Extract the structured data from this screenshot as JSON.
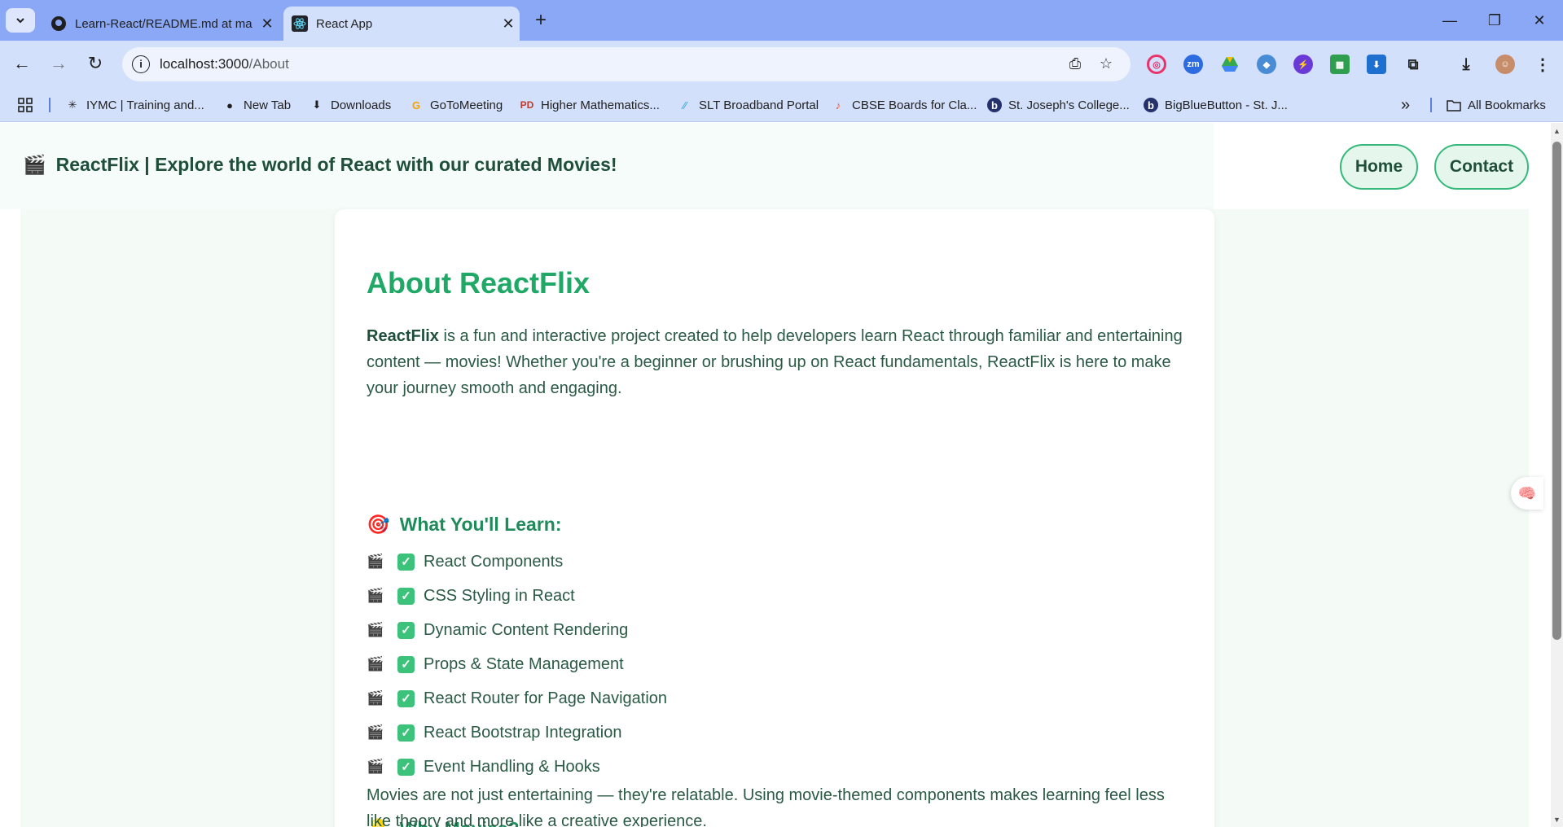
{
  "browser": {
    "tabs": [
      {
        "title": "Learn-React/README.md at ma",
        "favicon": "github-icon",
        "active": false
      },
      {
        "title": "React App",
        "favicon": "react-icon",
        "active": true
      }
    ],
    "url_host": "localhost:3000",
    "url_path": "/About",
    "bookmarks": [
      {
        "label": "IYMC | Training and...",
        "icon": "iymc-icon"
      },
      {
        "label": "New Tab",
        "icon": "globe-icon"
      },
      {
        "label": "Downloads",
        "icon": "download-icon"
      },
      {
        "label": "GoToMeeting",
        "icon": "gotomeeting-icon"
      },
      {
        "label": "Higher Mathematics...",
        "icon": "pdf-icon"
      },
      {
        "label": "SLT Broadband Portal",
        "icon": "slt-icon"
      },
      {
        "label": "CBSE Boards for Cla...",
        "icon": "cbse-icon"
      },
      {
        "label": "St. Joseph's College...",
        "icon": "bigbluebutton-icon"
      },
      {
        "label": "BigBlueButton - St. J...",
        "icon": "bigbluebutton-icon"
      }
    ],
    "all_bookmarks": "All Bookmarks",
    "overflow": "»"
  },
  "site": {
    "clapper": "🎬",
    "title": "ReactFlix | Explore the world of React with our curated Movies!",
    "nav": {
      "home": "Home",
      "contact": "Contact"
    }
  },
  "about": {
    "title": "About ReactFlix",
    "intro_bold": "ReactFlix",
    "intro_rest": " is a fun and interactive project created to help developers learn React through familiar and entertaining content — movies! Whether you're a beginner or brushing up on React fundamentals, ReactFlix is here to make your journey smooth and engaging.",
    "learn_emoji": "🎯",
    "learn_heading": "What You'll Learn:",
    "learn_items": [
      "React Components",
      "CSS Styling in React",
      "Dynamic Content Rendering",
      "Props & State Management",
      "React Router for Page Navigation",
      "React Bootstrap Integration",
      "Event Handling & Hooks"
    ],
    "item_emoji": "🎬",
    "check_mark": "✓",
    "why_emoji": "💡",
    "why_heading": "Why Movies?",
    "why_text": "Movies are not just entertaining — they're relatable. Using movie-themed components makes learning feel less like theory and more like a creative experience."
  },
  "colors": {
    "accent": "#1fa866",
    "heading": "#1f8a5a",
    "text": "#2a5a44",
    "pill_border": "#35b97a",
    "chrome": "#8aa8f5"
  }
}
